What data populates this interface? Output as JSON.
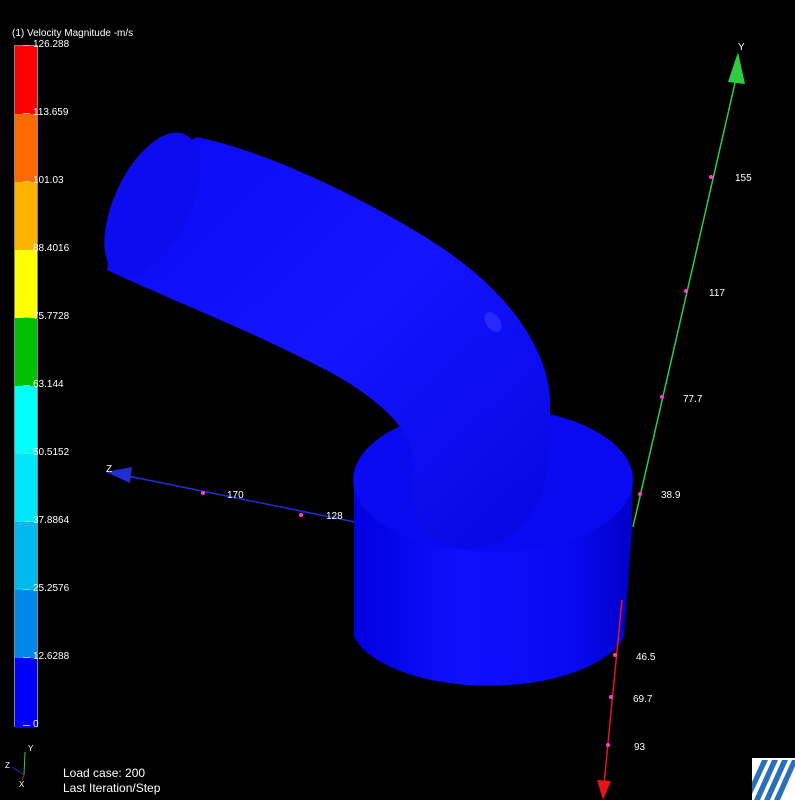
{
  "legend": {
    "title": "(1) Velocity Magnitude -m/s",
    "ticks": [
      "126.288",
      "113.659",
      "101.03",
      "88.4016",
      "75.7728",
      "63.144",
      "50.5152",
      "37.8864",
      "25.2576",
      "12.6288",
      "0"
    ],
    "colors": [
      "#ff0000",
      "#ff6a00",
      "#ffb300",
      "#ffff00",
      "#00c000",
      "#00ffff",
      "#00e6ff",
      "#00b8f0",
      "#0088e8",
      "#0050e0",
      "#0000ff"
    ]
  },
  "axes": {
    "y": {
      "label": "Y",
      "ticks": [
        "155",
        "117",
        "77.7",
        "38.9"
      ],
      "color": "#2ecc40"
    },
    "z": {
      "label": "Z",
      "ticks": [
        "170",
        "128"
      ],
      "color": "#1f2fd6"
    },
    "x": {
      "ticks": [
        "46.5",
        "69.7",
        "93"
      ],
      "color": "#e8141a"
    }
  },
  "triad": {
    "y": "Y",
    "z": "Z",
    "x": "X"
  },
  "model": {
    "color": "#0a0af0"
  },
  "status": {
    "load_case": "Load case: 200",
    "step": "Last Iteration/Step"
  }
}
